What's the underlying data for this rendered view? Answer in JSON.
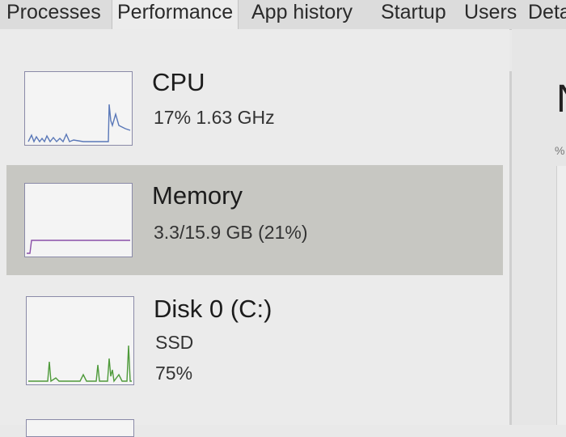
{
  "tabs": [
    {
      "label": "Processes"
    },
    {
      "label": "Performance"
    },
    {
      "label": "App history"
    },
    {
      "label": "Startup"
    },
    {
      "label": "Users"
    },
    {
      "label": "Deta"
    }
  ],
  "sidebar": {
    "items": [
      {
        "title": "CPU",
        "detail": "17%  1.63 GHz",
        "graph_color": "#5a78b8"
      },
      {
        "title": "Memory",
        "detail": "3.3/15.9 GB (21%)",
        "graph_color": "#8a4fa8"
      },
      {
        "title": "Disk 0 (C:)",
        "detail_line1": "SSD",
        "detail_line2": "75%",
        "graph_color": "#4e9a3a"
      }
    ]
  },
  "right_panel": {
    "header": "N",
    "sub": "%"
  },
  "colors": {
    "selected_bg": "#c7c7c2",
    "thumb_border": "#8a8aa8"
  }
}
